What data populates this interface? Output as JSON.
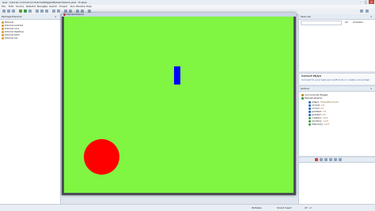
{
  "app": {
    "title": "Java - tutorial-common/src/tutorial/Wiggle/MyGameGame.java - Eclipse",
    "menu": [
      "File",
      "Edit",
      "Source",
      "Refactor",
      "Navigate",
      "Search",
      "Project",
      "Run",
      "Window",
      "Help"
    ]
  },
  "left_panel": {
    "title": "Package Explorer",
    "items": [
      "Tutorial",
      "tutorial-android",
      "tutorial-core",
      "tutorial-desktop",
      "tutorial-html",
      "tutorial-ios"
    ]
  },
  "game_window": {
    "title": "MyGameGame"
  },
  "right_top": {
    "title": "Task List",
    "filter_all": "All",
    "filter_activate": "Activate..."
  },
  "right_mid": {
    "title": "Connect Mylyn",
    "line1": "Connect to your task and ALM tools or create a local task."
  },
  "outline": {
    "title": "Outline",
    "items": [
      {
        "label": "com.tutorial.Wiggle",
        "detail": ""
      },
      {
        "label": "MyGameGame",
        "detail": ""
      },
      {
        "label": "shape",
        "detail": ": ShapeRenderer"
      },
      {
        "label": "circleX",
        "detail": ": int"
      },
      {
        "label": "circleY",
        "detail": ": int"
      },
      {
        "label": "paddleX",
        "detail": ": int"
      },
      {
        "label": "paddleY",
        "detail": ": int"
      },
      {
        "label": "create()",
        "detail": ": void"
      },
      {
        "label": "render()",
        "detail": ": void"
      },
      {
        "label": "dispose()",
        "detail": ": void"
      }
    ]
  },
  "status": {
    "writable": "Writable",
    "insert": "Smart Insert",
    "position": "27 : 2"
  },
  "colors": {
    "canvas": "#80f542",
    "paddle": "#0000ff",
    "ball": "#ff0000"
  }
}
